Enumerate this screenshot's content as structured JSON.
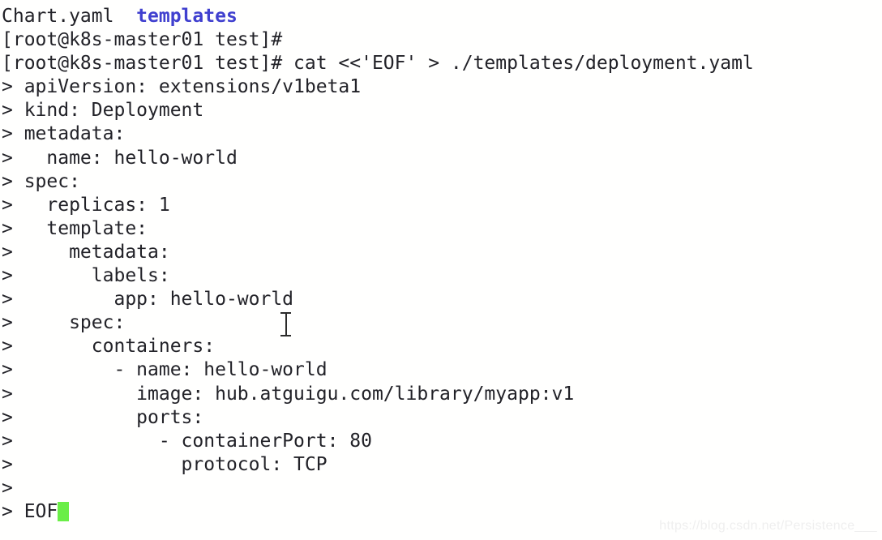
{
  "terminal": {
    "prompt": "[root@k8s-master01 test]#",
    "continuation_prompt": ">",
    "colors": {
      "background": "#fffffe",
      "foreground": "#222228",
      "directory": "#4040cf",
      "cursor": "#6aee47"
    },
    "lines": [
      {
        "id": "ls-output",
        "segments": [
          {
            "text": "Chart.yaml  ",
            "style": "default"
          },
          {
            "text": "templates",
            "style": "directory"
          }
        ]
      },
      {
        "id": "prompt-idle",
        "segments": [
          {
            "text": "[root@k8s-master01 test]# ",
            "style": "default"
          }
        ]
      },
      {
        "id": "command-heredoc",
        "segments": [
          {
            "text": "[root@k8s-master01 test]# cat <<'EOF' > ./templates/deployment.yaml",
            "style": "default"
          }
        ]
      },
      {
        "id": "heredoc-01",
        "segments": [
          {
            "text": "> apiVersion: extensions/v1beta1",
            "style": "default"
          }
        ]
      },
      {
        "id": "heredoc-02",
        "segments": [
          {
            "text": "> kind: Deployment",
            "style": "default"
          }
        ]
      },
      {
        "id": "heredoc-03",
        "segments": [
          {
            "text": "> metadata:",
            "style": "default"
          }
        ]
      },
      {
        "id": "heredoc-04",
        "segments": [
          {
            "text": ">   name: hello-world",
            "style": "default"
          }
        ]
      },
      {
        "id": "heredoc-05",
        "segments": [
          {
            "text": "> spec:",
            "style": "default"
          }
        ]
      },
      {
        "id": "heredoc-06",
        "segments": [
          {
            "text": ">   replicas: 1",
            "style": "default"
          }
        ]
      },
      {
        "id": "heredoc-07",
        "segments": [
          {
            "text": ">   template:",
            "style": "default"
          }
        ]
      },
      {
        "id": "heredoc-08",
        "segments": [
          {
            "text": ">     metadata:",
            "style": "default"
          }
        ]
      },
      {
        "id": "heredoc-09",
        "segments": [
          {
            "text": ">       labels:",
            "style": "default"
          }
        ]
      },
      {
        "id": "heredoc-10",
        "segments": [
          {
            "text": ">         app: hello-world",
            "style": "default"
          }
        ]
      },
      {
        "id": "heredoc-11",
        "segments": [
          {
            "text": ">     spec:",
            "style": "default"
          }
        ]
      },
      {
        "id": "heredoc-12",
        "segments": [
          {
            "text": ">       containers:",
            "style": "default"
          }
        ]
      },
      {
        "id": "heredoc-13",
        "segments": [
          {
            "text": ">         - name: hello-world",
            "style": "default"
          }
        ]
      },
      {
        "id": "heredoc-14",
        "segments": [
          {
            "text": ">           image: hub.atguigu.com/library/myapp:v1",
            "style": "default"
          }
        ]
      },
      {
        "id": "heredoc-15",
        "segments": [
          {
            "text": ">           ports:",
            "style": "default"
          }
        ]
      },
      {
        "id": "heredoc-16",
        "segments": [
          {
            "text": ">             - containerPort: 80",
            "style": "default"
          }
        ]
      },
      {
        "id": "heredoc-17",
        "segments": [
          {
            "text": ">               protocol: TCP",
            "style": "default"
          }
        ]
      },
      {
        "id": "heredoc-18",
        "segments": [
          {
            "text": ">",
            "style": "default"
          }
        ]
      },
      {
        "id": "heredoc-terminator",
        "segments": [
          {
            "text": "> EOF",
            "style": "default"
          }
        ],
        "cursor": true
      }
    ]
  },
  "watermark": {
    "text": "https://blog.csdn.net/Persistence___"
  }
}
